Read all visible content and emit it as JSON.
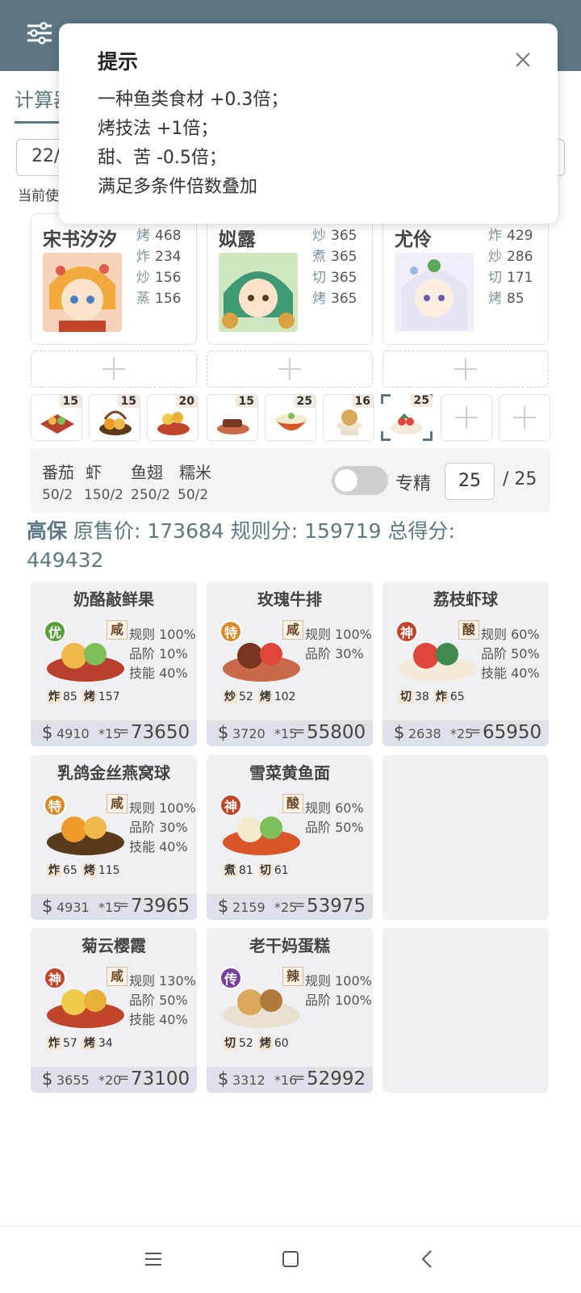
{
  "tabs": {
    "active": "计算器"
  },
  "date": {
    "value": "22/"
  },
  "current_label": "当前使",
  "popup": {
    "title": "提示",
    "lines": [
      "一种鱼类食材 +0.3倍；",
      "烤技法 +1倍；",
      "甜、苦 -0.5倍；",
      "满足多条件倍数叠加"
    ]
  },
  "chefs": [
    {
      "name": "宋书汐汐",
      "skills": [
        {
          "k": "烤",
          "v": "468"
        },
        {
          "k": "炸",
          "v": "234"
        },
        {
          "k": "炒",
          "v": "156"
        },
        {
          "k": "蒸",
          "v": "156"
        }
      ]
    },
    {
      "name": "姒露",
      "skills": [
        {
          "k": "炒",
          "v": "365"
        },
        {
          "k": "煮",
          "v": "365"
        },
        {
          "k": "切",
          "v": "365"
        },
        {
          "k": "烤",
          "v": "365"
        }
      ]
    },
    {
      "name": "尤伶",
      "skills": [
        {
          "k": "炸",
          "v": "429"
        },
        {
          "k": "炒",
          "v": "286"
        },
        {
          "k": "切",
          "v": "171"
        },
        {
          "k": "烤",
          "v": "85"
        }
      ]
    }
  ],
  "slots": [
    "15",
    "15",
    "20",
    "15",
    "25",
    "16",
    "25"
  ],
  "ingredients": {
    "names": [
      "番茄",
      "虾",
      "鱼翅",
      "糯米"
    ],
    "values": [
      "50/2",
      "150/2",
      "250/2",
      "50/2"
    ],
    "spec_label": "专精",
    "spec_value": "25",
    "spec_max": "/ 25"
  },
  "summary": {
    "tag": "高保",
    "orig_label": "原售价:",
    "orig_value": "173684",
    "rule_label": "规则分:",
    "rule_value": "159719",
    "total_label": "总得分:",
    "total_value": "449432"
  },
  "recipes": [
    {
      "name": "奶酪敲鲜果",
      "grade": "优",
      "taste": "咸",
      "rules": [
        "规则 100%",
        "品阶 10%",
        "技能 40%"
      ],
      "tags": [
        {
          "k": "炸",
          "v": "85"
        },
        {
          "k": "烤",
          "v": "157"
        }
      ],
      "price": "4910",
      "mult": "*15",
      "total": "73650"
    },
    {
      "name": "玫瑰牛排",
      "grade": "特",
      "taste": "咸",
      "rules": [
        "规则 100%",
        "品阶 30%"
      ],
      "tags": [
        {
          "k": "炒",
          "v": "52"
        },
        {
          "k": "烤",
          "v": "102"
        }
      ],
      "price": "3720",
      "mult": "*15",
      "total": "55800"
    },
    {
      "name": "荔枝虾球",
      "grade": "神",
      "taste": "酸",
      "rules": [
        "规则 60%",
        "品阶 50%",
        "技能 40%"
      ],
      "tags": [
        {
          "k": "切",
          "v": "38"
        },
        {
          "k": "炸",
          "v": "65"
        }
      ],
      "price": "2638",
      "mult": "*25",
      "total": "65950"
    },
    {
      "name": "乳鸽金丝燕窝球",
      "grade": "特",
      "taste": "咸",
      "rules": [
        "规则 100%",
        "品阶 30%",
        "技能 40%"
      ],
      "tags": [
        {
          "k": "炸",
          "v": "65"
        },
        {
          "k": "烤",
          "v": "115"
        }
      ],
      "price": "4931",
      "mult": "*15",
      "total": "73965"
    },
    {
      "name": "雪菜黄鱼面",
      "grade": "神",
      "taste": "酸",
      "rules": [
        "规则 60%",
        "品阶 50%"
      ],
      "tags": [
        {
          "k": "煮",
          "v": "81"
        },
        {
          "k": "切",
          "v": "61"
        }
      ],
      "price": "2159",
      "mult": "*25",
      "total": "53975"
    },
    {
      "name": "菊云樱霞",
      "grade": "神",
      "taste": "咸",
      "rules": [
        "规则 130%",
        "品阶 50%",
        "技能 40%"
      ],
      "tags": [
        {
          "k": "炸",
          "v": "57"
        },
        {
          "k": "烤",
          "v": "34"
        }
      ],
      "price": "3655",
      "mult": "*20",
      "total": "73100"
    },
    {
      "name": "老干妈蛋糕",
      "grade": "传",
      "taste": "辣",
      "rules": [
        "规则 100%",
        "品阶 100%"
      ],
      "tags": [
        {
          "k": "切",
          "v": "52"
        },
        {
          "k": "烤",
          "v": "60"
        }
      ],
      "price": "3312",
      "mult": "*16",
      "total": "52992"
    }
  ],
  "currency_symbol": "$",
  "eq_symbol": "=",
  "grade_colors": {
    "优": "#5a9e3a",
    "特": "#d98a2b",
    "神": "#c0452a",
    "传": "#7a3f9e"
  }
}
